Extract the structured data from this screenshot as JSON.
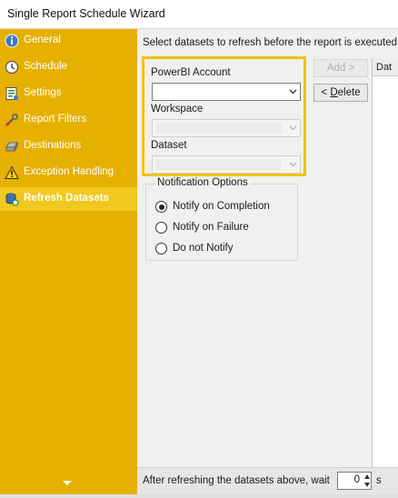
{
  "window": {
    "title": "Single Report Schedule Wizard"
  },
  "sidebar": {
    "items": [
      {
        "label": "General",
        "icon": "info-icon",
        "active": false
      },
      {
        "label": "Schedule",
        "icon": "clock-icon",
        "active": false
      },
      {
        "label": "Settings",
        "icon": "settings-list-icon",
        "active": false
      },
      {
        "label": "Report Filters",
        "icon": "wrench-icon",
        "active": false
      },
      {
        "label": "Destinations",
        "icon": "drive-icon",
        "active": false
      },
      {
        "label": "Exception Handling",
        "icon": "warning-icon",
        "active": false
      },
      {
        "label": "Refresh Datasets",
        "icon": "database-refresh-icon",
        "active": true
      }
    ]
  },
  "main": {
    "instruction": "Select datasets to refresh before the report is executed",
    "powerbi_account_label": "PowerBI Account",
    "powerbi_account_value": "",
    "workspace_label": "Workspace",
    "workspace_value": "",
    "dataset_label": "Dataset",
    "dataset_value": "",
    "add_button": "Add >",
    "delete_prefix": "< ",
    "delete_accel": "D",
    "delete_rest": "elete",
    "list_header": "Dat"
  },
  "notification": {
    "title": "Notification Options",
    "options": [
      {
        "label": "Notify on Completion",
        "selected": true
      },
      {
        "label": "Notify on Failure",
        "selected": false
      },
      {
        "label": "Do not Notify",
        "selected": false
      }
    ]
  },
  "footer": {
    "text": "After refreshing the datasets above, wait",
    "wait_value": "0",
    "tail": "s"
  },
  "colors": {
    "sidebar_bg": "#e6b000",
    "sidebar_active": "#f0c81e",
    "highlight_border": "#f2c200"
  }
}
